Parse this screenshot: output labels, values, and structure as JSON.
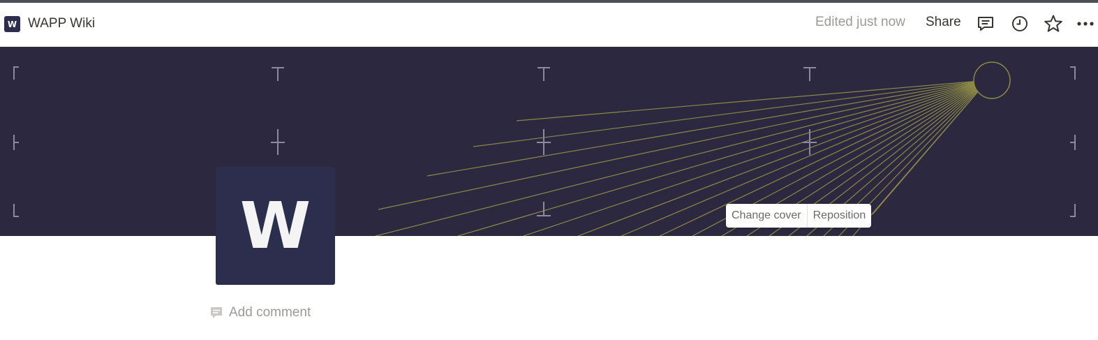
{
  "topbar": {
    "workspace_logo_letter": "W",
    "page_name": "WAPP Wiki",
    "edited_status": "Edited just now",
    "share_label": "Share",
    "icons": [
      "comments-icon",
      "history-icon",
      "favorite-star-icon",
      "more-options-icon"
    ]
  },
  "cover": {
    "background_color": "#2c283f",
    "line_color": "#8b8a46",
    "change_cover_label": "Change cover",
    "reposition_label": "Reposition"
  },
  "page": {
    "icon_letter": "W",
    "icon_color": "#2d2d4e",
    "add_comment_label": "Add comment"
  }
}
